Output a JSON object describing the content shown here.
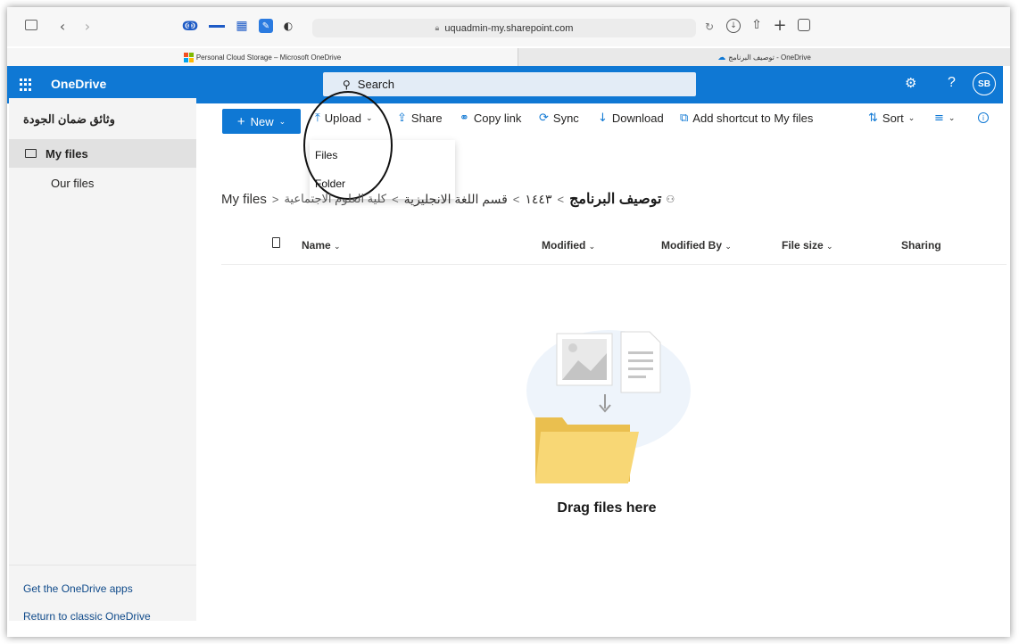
{
  "browser": {
    "url": "uquadmin-my.sharepoint.com",
    "tabs": [
      {
        "label": "Personal Cloud Storage – Microsoft OneDrive"
      },
      {
        "label": "توصيف البرنامج - OneDrive"
      }
    ]
  },
  "suite": {
    "app_name": "OneDrive",
    "search_label": "Search",
    "avatar_initials": "SB",
    "help_label": "?"
  },
  "sidebar": {
    "title": "وثائق ضمان الجودة",
    "items": [
      {
        "label": "My files",
        "selected": true
      },
      {
        "label": "Our files",
        "selected": false
      }
    ],
    "links": [
      "Get the OneDrive apps",
      "Return to classic OneDrive"
    ]
  },
  "commands": {
    "new_label": "New",
    "upload_label": "Upload",
    "share_label": "Share",
    "copy_link_label": "Copy link",
    "sync_label": "Sync",
    "download_label": "Download",
    "add_shortcut_label": "Add shortcut to My files",
    "sort_label": "Sort"
  },
  "upload_menu": {
    "items": [
      "Files",
      "Folder"
    ]
  },
  "breadcrumb": {
    "items": [
      "My files",
      "كلية العلوم الاجتماعية",
      "قسم اللغة الانجليزية",
      "١٤٤٣",
      "توصيف البرنامج"
    ]
  },
  "columns": {
    "name": "Name",
    "modified": "Modified",
    "modified_by": "Modified By",
    "file_size": "File size",
    "sharing": "Sharing"
  },
  "empty_state": {
    "message": "Drag files here"
  },
  "colors": {
    "accent": "#0f78d4",
    "folder": "#f8d775",
    "folder_back": "#eabf4f"
  }
}
